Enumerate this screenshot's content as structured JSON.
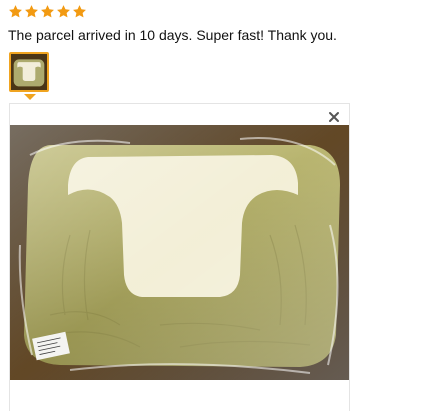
{
  "review": {
    "rating": 5,
    "rating_max": 5,
    "text": "The parcel arrived in 10 days. Super fast! Thank you."
  },
  "colors": {
    "star": "#f29a12",
    "thumb_border": "#f0a420",
    "cushion": "#a9a55c",
    "cushion_light": "#f3efd6",
    "background_photo": "#3a2a14"
  },
  "icons": {
    "star": "star-icon",
    "close": "close-icon"
  }
}
